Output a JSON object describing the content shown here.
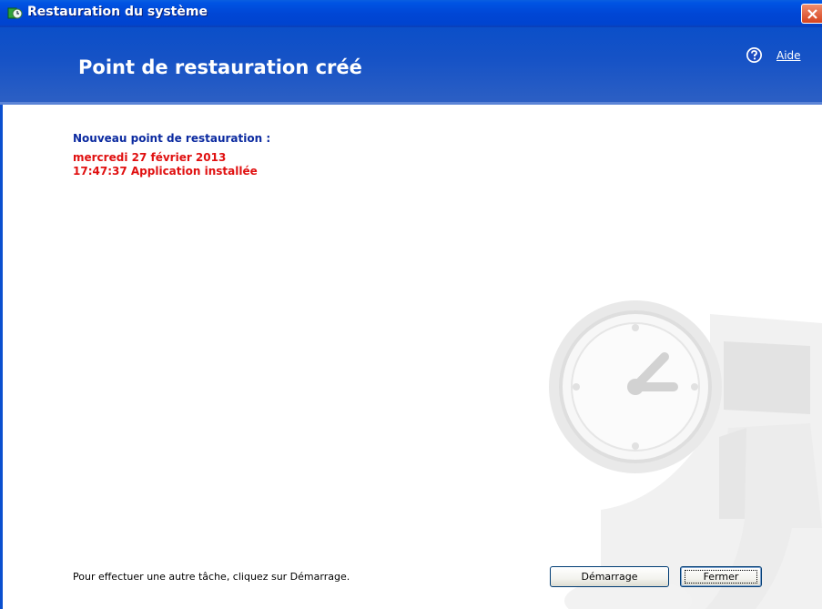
{
  "window": {
    "title": "Restauration du système"
  },
  "header": {
    "title": "Point de restauration créé",
    "help_label": "Aide"
  },
  "content": {
    "heading": "Nouveau point de restauration :",
    "date": "mercredi 27 février 2013",
    "time_and_description": "17:47:37  Application installée",
    "footer_text": "Pour effectuer une autre tâche, cliquez sur Démarrage."
  },
  "buttons": {
    "start_label": "Démarrage",
    "close_label": "Fermer"
  },
  "colors": {
    "titlebar": "#0046d5",
    "header": "#1552c6",
    "heading_text": "#0b2aa0",
    "highlight_text": "#e01010"
  },
  "icons": [
    "system-restore-icon",
    "close-icon",
    "help-icon",
    "clock-watermark-icon"
  ]
}
